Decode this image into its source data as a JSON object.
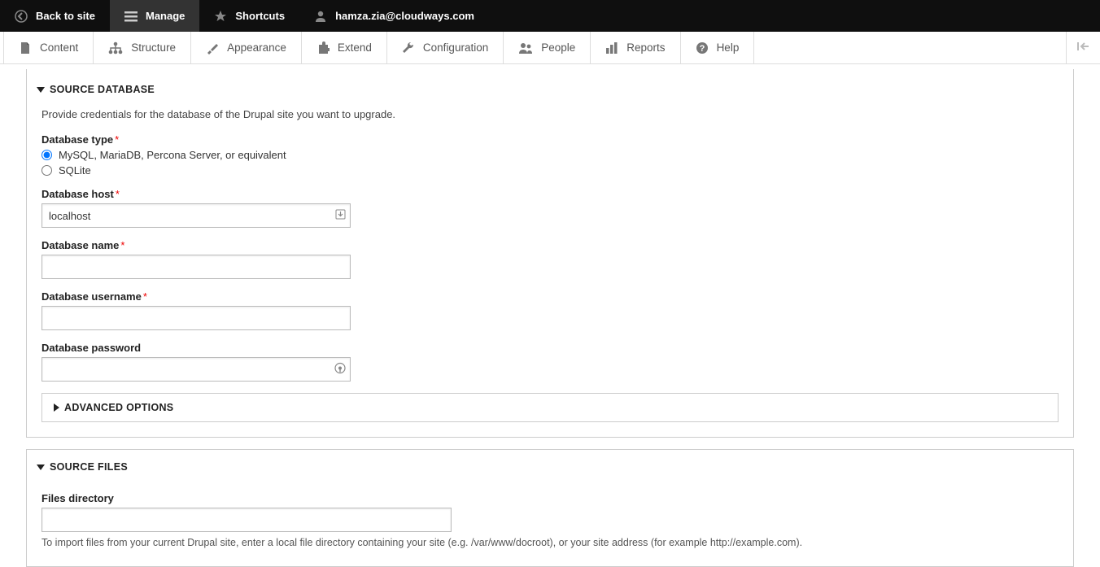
{
  "toolbar": {
    "back_to_site": "Back to site",
    "manage": "Manage",
    "shortcuts": "Shortcuts",
    "user_email": "hamza.zia@cloudways.com"
  },
  "admin_tabs": {
    "content": "Content",
    "structure": "Structure",
    "appearance": "Appearance",
    "extend": "Extend",
    "configuration": "Configuration",
    "people": "People",
    "reports": "Reports",
    "help": "Help"
  },
  "source_db": {
    "legend": "Source database",
    "description": "Provide credentials for the database of the Drupal site you want to upgrade.",
    "db_type_label": "Database type",
    "db_type_options": {
      "mysql": "MySQL, MariaDB, Percona Server, or equivalent",
      "sqlite": "SQLite"
    },
    "db_host_label": "Database host",
    "db_host_value": "localhost",
    "db_name_label": "Database name",
    "db_name_value": "",
    "db_user_label": "Database username",
    "db_user_value": "",
    "db_pass_label": "Database password",
    "db_pass_value": "",
    "advanced_legend": "Advanced options"
  },
  "source_files": {
    "legend": "Source files",
    "files_dir_label": "Files directory",
    "files_dir_value": "",
    "files_dir_help": "To import files from your current Drupal site, enter a local file directory containing your site (e.g. /var/www/docroot), or your site address (for example http://example.com)."
  }
}
